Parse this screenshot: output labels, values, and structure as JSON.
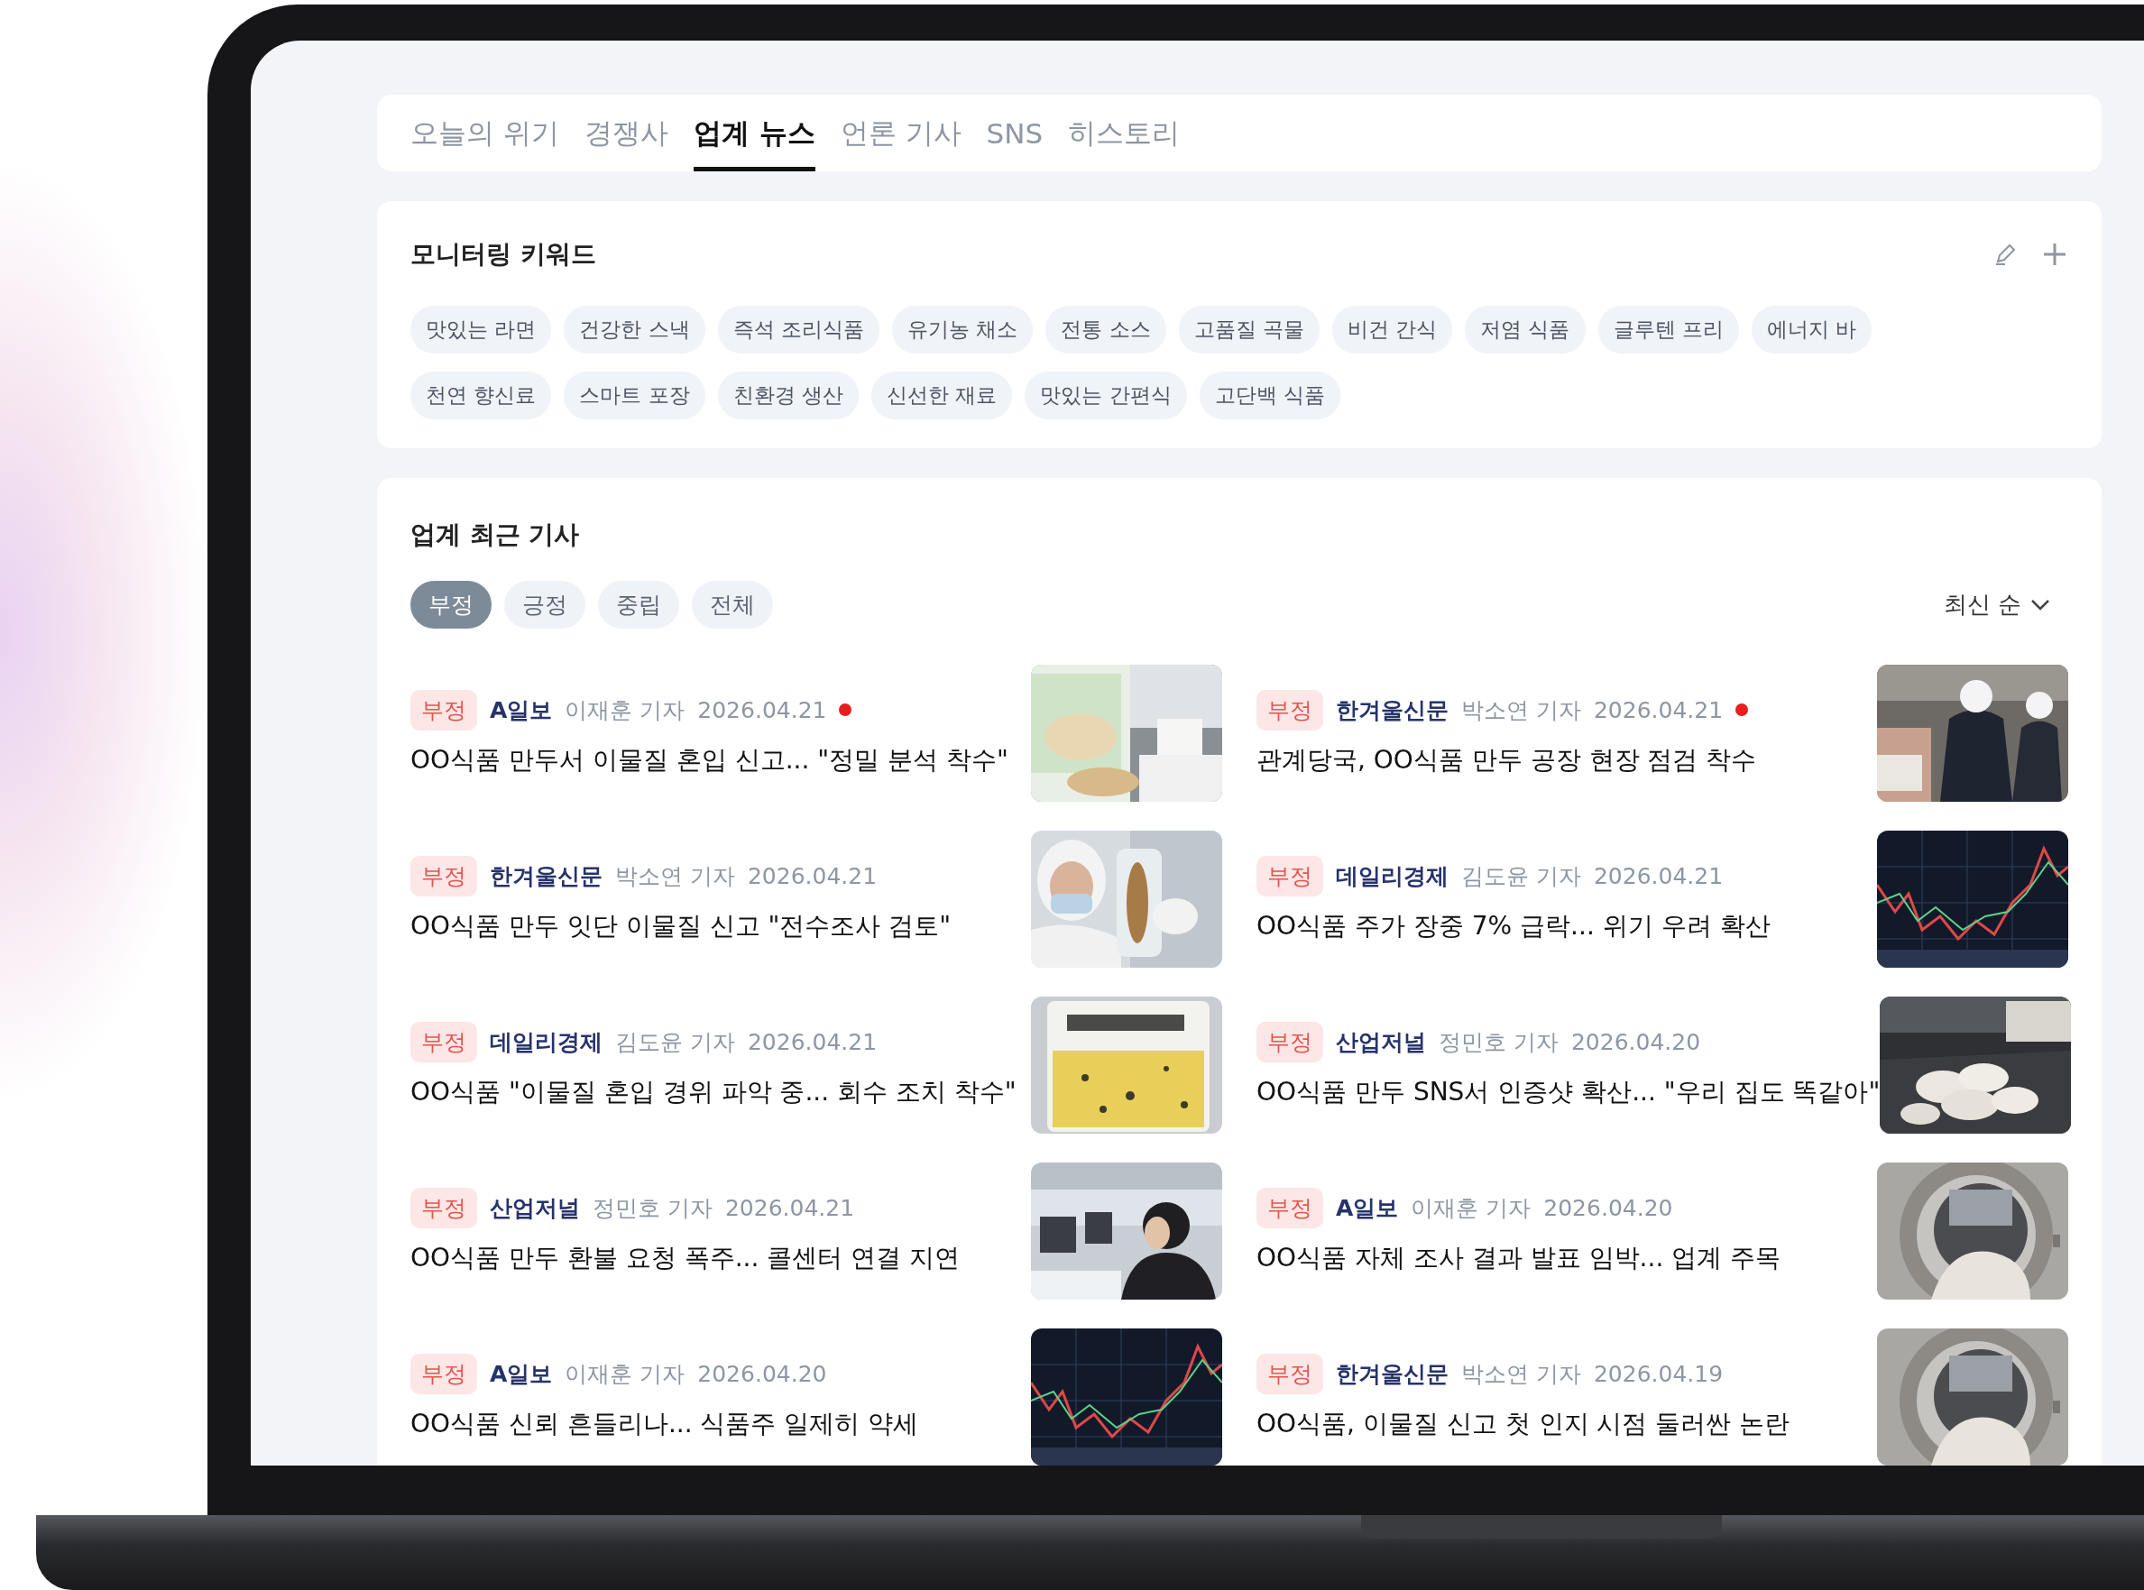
{
  "tabs": [
    {
      "label": "오늘의 위기",
      "selected": false
    },
    {
      "label": "경쟁사",
      "selected": false
    },
    {
      "label": "업계 뉴스",
      "selected": true
    },
    {
      "label": "언론 기사",
      "selected": false
    },
    {
      "label": "SNS",
      "selected": false
    },
    {
      "label": "히스토리",
      "selected": false
    }
  ],
  "keywords": {
    "title": "모니터링 키워드",
    "items": [
      "맛있는 라면",
      "건강한 스낵",
      "즉석 조리식품",
      "유기농 채소",
      "전통 소스",
      "고품질 곡물",
      "비건 간식",
      "저염 식품",
      "글루텐 프리",
      "에너지 바",
      "천연 향신료",
      "스마트 포장",
      "친환경 생산",
      "신선한 재료",
      "맛있는 간편식",
      "고단백 식품"
    ]
  },
  "articles": {
    "title": "업계 최근 기사",
    "filters": [
      {
        "label": "부정",
        "selected": true
      },
      {
        "label": "긍정",
        "selected": false
      },
      {
        "label": "중립",
        "selected": false
      },
      {
        "label": "전체",
        "selected": false
      }
    ],
    "sort": "최신 순",
    "items": [
      {
        "tag": "부정",
        "source": "A일보",
        "reporter": "이재훈 기자",
        "date": "2026.04.21",
        "new": true,
        "title": "OO식품 만두서 이물질 혼입 신고... \"정밀 분석 착수\"",
        "kind": "picture"
      },
      {
        "tag": "부정",
        "source": "한겨울신문",
        "reporter": "박소연 기자",
        "date": "2026.04.21",
        "new": true,
        "title": "관계당국, OO식품 만두 공장 현장 점검 착수",
        "kind": "picture"
      },
      {
        "tag": "부정",
        "source": "한겨울신문",
        "reporter": "박소연 기자",
        "date": "2026.04.21",
        "new": false,
        "title": "OO식품 만두 잇단 이물질 신고 \"전수조사 검토\"",
        "kind": "picture"
      },
      {
        "tag": "부정",
        "source": "데일리경제",
        "reporter": "김도윤 기자",
        "date": "2026.04.21",
        "new": false,
        "title": "OO식품 주가 장중 7% 급락... 위기 우려 확산",
        "kind": "picture"
      },
      {
        "tag": "부정",
        "source": "데일리경제",
        "reporter": "김도윤 기자",
        "date": "2026.04.21",
        "new": false,
        "title": "OO식품 \"이물질 혼입 경위 파악 중... 회수 조치 착수\"",
        "kind": "picture"
      },
      {
        "tag": "부정",
        "source": "산업저널",
        "reporter": "정민호 기자",
        "date": "2026.04.20",
        "new": false,
        "title": "OO식품 만두 SNS서 인증샷 확산... \"우리 집도 똑같아\"",
        "kind": "picture"
      },
      {
        "tag": "부정",
        "source": "산업저널",
        "reporter": "정민호 기자",
        "date": "2026.04.21",
        "new": false,
        "title": "OO식품 만두 환불 요청 폭주... 콜센터 연결 지연",
        "kind": "picture"
      },
      {
        "tag": "부정",
        "source": "A일보",
        "reporter": "이재훈 기자",
        "date": "2026.04.20",
        "new": false,
        "title": "OO식품 자체 조사 결과 발표 임박... 업계 주목",
        "kind": "picture"
      },
      {
        "tag": "부정",
        "source": "A일보",
        "reporter": "이재훈 기자",
        "date": "2026.04.20",
        "new": false,
        "title": "OO식품 신뢰 흔들리나... 식품주 일제히 약세",
        "kind": "picture"
      },
      {
        "tag": "부정",
        "source": "한겨울신문",
        "reporter": "박소연 기자",
        "date": "2026.04.19",
        "new": false,
        "title": "OO식품, 이물질 신고 첫 인지 시점 둘러싼 논란",
        "kind": "picture"
      }
    ]
  }
}
